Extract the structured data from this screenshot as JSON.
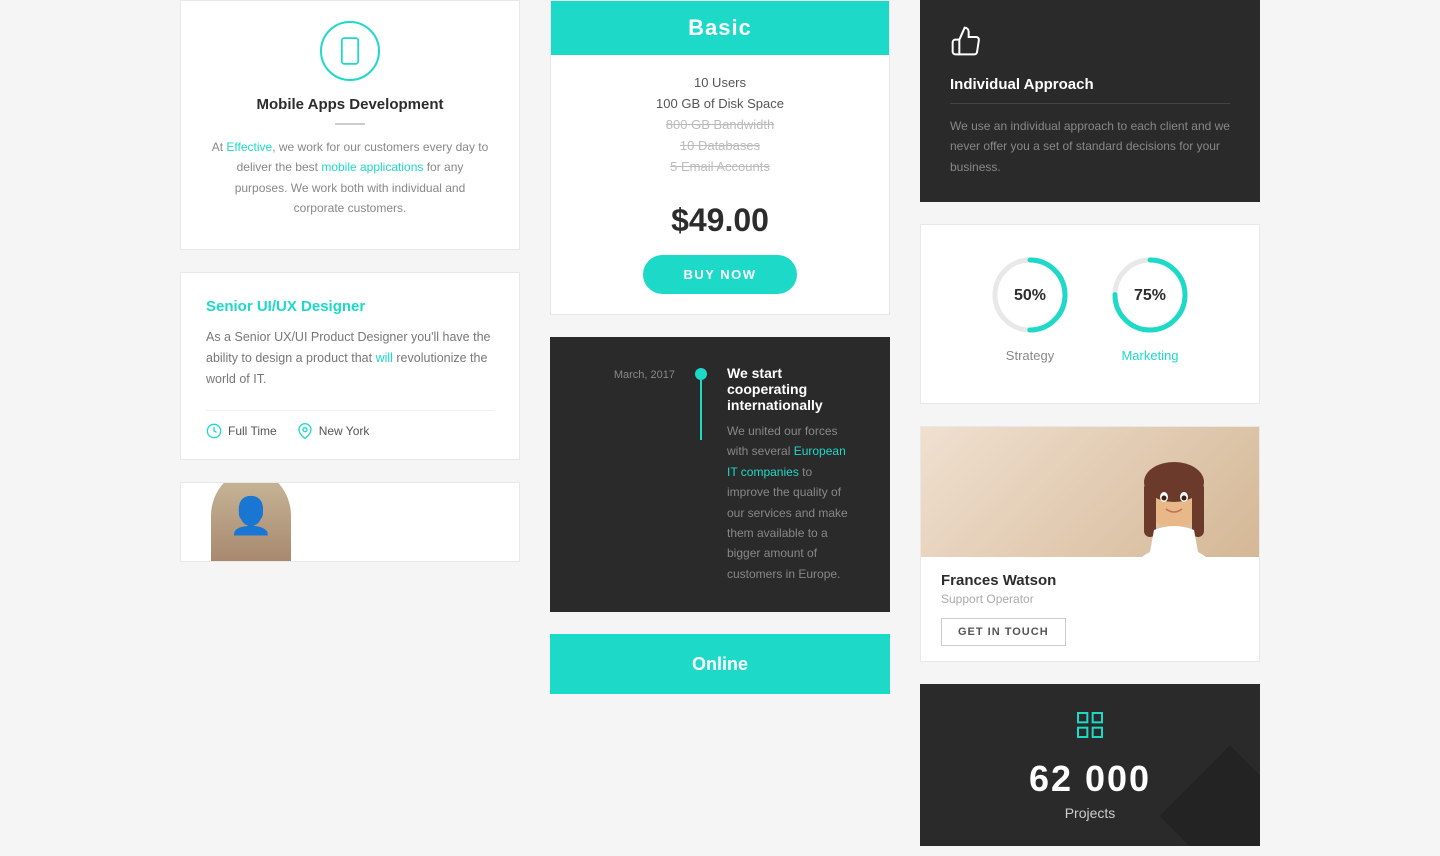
{
  "col1": {
    "mobile_card": {
      "title": "Mobile Apps Development",
      "description_parts": [
        "At Effective, we work for our customers every day to deliver the best",
        " mobile applications",
        " for any purposes. We work both with individual and corporate customers."
      ],
      "full_text": "At Effective, we work for our customers every day to deliver the best mobile applications for any purposes. We work both with individual and corporate customers."
    },
    "job_card": {
      "title": "Senior UI/UX Designer",
      "description": "As a Senior UX/UI Product Designer you'll have the ability to design a product that will revolutionize the world of IT.",
      "meta": {
        "type": "Full Time",
        "location": "New York"
      }
    }
  },
  "col2": {
    "pricing_card": {
      "plan": "Basic",
      "features": [
        {
          "text": "10 Users",
          "strikethrough": false
        },
        {
          "text": "100 GB of Disk Space",
          "strikethrough": false
        },
        {
          "text": "800 GB Bandwidth",
          "strikethrough": true
        },
        {
          "text": "10 Databases",
          "strikethrough": true
        },
        {
          "text": "5 Email Accounts",
          "strikethrough": true
        }
      ],
      "price": "$49.00",
      "cta": "BUY NOW"
    },
    "timeline_card": {
      "date": "March, 2017",
      "title": "We start cooperating internationally",
      "description_parts": [
        "We united our forces with several",
        " European IT companies",
        " to improve the quality of our services and make them available to a bigger amount of customers in Europe."
      ],
      "full_description": "We united our forces with several European IT companies to improve the quality of our services and make them available to a bigger amount of customers in Europe."
    }
  },
  "col3": {
    "approach_card": {
      "title": "Individual Approach",
      "description": "We use an individual approach to each client and we never offer you a set of standard decisions for your business."
    },
    "skills_card": {
      "rings": [
        {
          "label": "Strategy",
          "label_class": "normal",
          "percent": 50,
          "color": "#cccccc"
        },
        {
          "label": "Marketing",
          "label_class": "teal",
          "percent": 75,
          "color": "#1dd9c8"
        }
      ]
    },
    "frances_card": {
      "name": "Frances Watson",
      "role": "Support Operator",
      "cta": "GET IN TOUCH"
    },
    "stats_card": {
      "number": "62 000",
      "label": "Projects"
    }
  },
  "bottom": {
    "green_btn_text": "Online"
  }
}
